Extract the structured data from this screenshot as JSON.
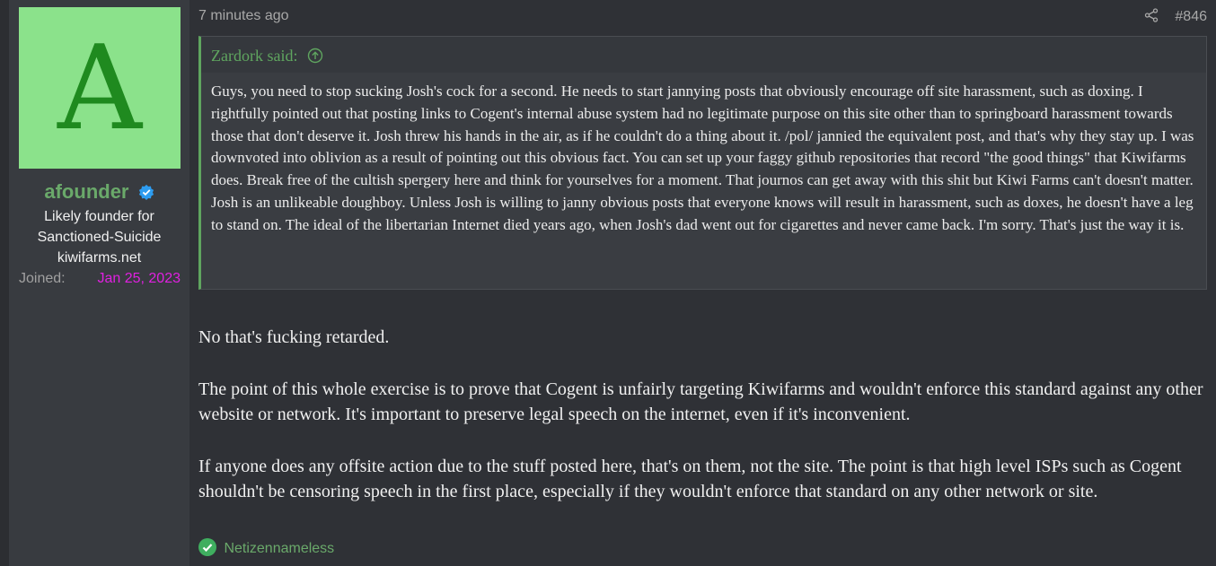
{
  "user": {
    "avatar_letter": "A",
    "avatar_bg": "#8be28b",
    "avatar_fg": "#1f8a1f",
    "name": "afounder",
    "name_color": "#6aa96a",
    "verified_icon": "verified-badge-icon",
    "title_lines": [
      "Likely founder for",
      "Sanctioned-Suicide",
      "kiwifarms.net"
    ],
    "joined_label": "Joined:",
    "joined_value": "Jan 25, 2023"
  },
  "post": {
    "time": "7 minutes ago",
    "share_icon": "share-icon",
    "number": "#846",
    "quote": {
      "author_said": "Zardork said:",
      "text": "Guys, you need to stop sucking Josh's cock for a second. He needs to start jannying posts that obviously encourage off site harassment, such as doxing. I rightfully pointed out that posting links to Cogent's internal abuse system had no legitimate purpose on this site other than to springboard harassment towards those that don't deserve it. Josh threw his hands in the air, as if he couldn't do a thing about it. /pol/ jannied the equivalent post, and that's why they stay up. I was downvoted into oblivion as a result of pointing out this obvious fact. You can set up your faggy github repositories that record \"the good things\" that Kiwifarms does. Break free of the cultish spergery here and think for yourselves for a moment. That journos can get away with this shit but Kiwi Farms can't doesn't matter. Josh is an unlikeable doughboy. Unless Josh is willing to janny obvious posts that everyone knows will result in harassment, such as doxes, he doesn't have a leg to stand on. The ideal of the libertarian Internet died years ago, when Josh's dad went out for cigarettes and never came back. I'm sorry. That's just the way it is."
    },
    "paragraphs": [
      "No that's fucking retarded.",
      "The point of this whole exercise is to prove that Cogent is unfairly targeting Kiwifarms and wouldn't enforce this standard against any other website or network. It's important to preserve legal speech on the internet, even if it's inconvenient.",
      "If anyone does any offsite action due to the stuff posted here, that's on them, not the site. The point is that high level ISPs such as Cogent shouldn't be censoring speech in the first place, especially if they wouldn't enforce that standard on any other network or site."
    ],
    "reaction_user": "Netizennameless"
  },
  "colors": {
    "accent_green": "#5fa55f",
    "joined_value": "#e020e0",
    "background": "#2f3136"
  }
}
